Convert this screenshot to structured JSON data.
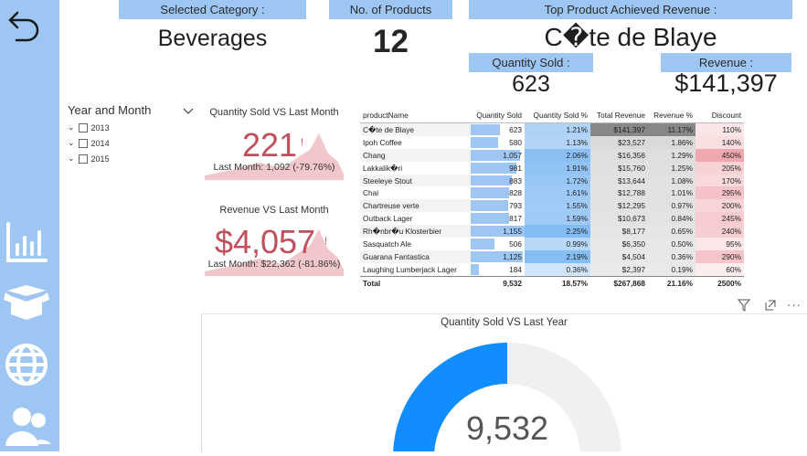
{
  "header": {
    "selected_category_label": "Selected Category :",
    "selected_category_value": "Beverages",
    "num_products_label": "No. of Products",
    "num_products_value": "12",
    "top_product_label": "Top Product Achieved Revenue :",
    "top_product_value": "C�te de Blaye",
    "qty_sold_label": "Quantity Sold :",
    "qty_sold_value": "623",
    "revenue_label": "Revenue :",
    "revenue_value": "$141,397"
  },
  "slicer": {
    "title": "Year and Month",
    "years": [
      "2013",
      "2014",
      "2015"
    ]
  },
  "kpi_qty": {
    "title": "Quantity Sold VS Last Month",
    "value": "221",
    "indicator": "!",
    "sub": "Last Month: 1,092 (-79.76%)"
  },
  "kpi_rev": {
    "title": "Revenue VS Last Month",
    "value": "$4,057",
    "indicator": "!",
    "sub": "Last Month: $22,362 (-81.86%)"
  },
  "matrix": {
    "columns": [
      "productName",
      "Quantity Sold",
      "Quantity Sold %",
      "Total Revenue",
      "Revenue %",
      "Discount"
    ],
    "rows": [
      {
        "name": "C�te de Blaye",
        "qty": "623",
        "qty_pct": "1.21%",
        "rev": "$141,397",
        "rev_pct": "11.17%",
        "disc": "110%"
      },
      {
        "name": "Ipoh Coffee",
        "qty": "580",
        "qty_pct": "1.13%",
        "rev": "$23,527",
        "rev_pct": "1.86%",
        "disc": "140%"
      },
      {
        "name": "Chang",
        "qty": "1,057",
        "qty_pct": "2.06%",
        "rev": "$16,356",
        "rev_pct": "1.29%",
        "disc": "450%"
      },
      {
        "name": "Lakkalik�ri",
        "qty": "981",
        "qty_pct": "1.91%",
        "rev": "$15,760",
        "rev_pct": "1.25%",
        "disc": "205%"
      },
      {
        "name": "Steeleye Stout",
        "qty": "883",
        "qty_pct": "1.72%",
        "rev": "$13,644",
        "rev_pct": "1.08%",
        "disc": "170%"
      },
      {
        "name": "Chai",
        "qty": "828",
        "qty_pct": "1.61%",
        "rev": "$12,788",
        "rev_pct": "1.01%",
        "disc": "295%"
      },
      {
        "name": "Chartreuse verte",
        "qty": "793",
        "qty_pct": "1.55%",
        "rev": "$12,295",
        "rev_pct": "0.97%",
        "disc": "200%"
      },
      {
        "name": "Outback Lager",
        "qty": "817",
        "qty_pct": "1.59%",
        "rev": "$10,673",
        "rev_pct": "0.84%",
        "disc": "245%"
      },
      {
        "name": "Rh�nbr�u Klosterbier",
        "qty": "1,155",
        "qty_pct": "2.25%",
        "rev": "$8,177",
        "rev_pct": "0.65%",
        "disc": "240%"
      },
      {
        "name": "Sasquatch Ale",
        "qty": "506",
        "qty_pct": "0.99%",
        "rev": "$6,350",
        "rev_pct": "0.50%",
        "disc": "95%"
      },
      {
        "name": "Guarana Fantastica",
        "qty": "1,125",
        "qty_pct": "2.19%",
        "rev": "$4,504",
        "rev_pct": "0.36%",
        "disc": "290%"
      },
      {
        "name": "Laughing Lumberjack Lager",
        "qty": "184",
        "qty_pct": "0.36%",
        "rev": "$2,397",
        "rev_pct": "0.19%",
        "disc": "60%"
      }
    ],
    "total": {
      "label": "Total",
      "qty": "9,532",
      "qty_pct": "18.57%",
      "rev": "$267,868",
      "rev_pct": "21.16%",
      "disc": "2500%"
    }
  },
  "gauge": {
    "title": "Quantity Sold VS Last Year",
    "value": "9,532",
    "fraction": 0.5
  },
  "icons": {
    "back": "undo-arrow-icon",
    "chart": "bar-chart-icon",
    "box": "open-box-icon",
    "globe": "globe-icon",
    "users": "users-icon",
    "filter": "filter-icon",
    "focus": "focus-mode-icon",
    "more": "more-options-icon"
  },
  "colors": {
    "accent": "#9ec6f2",
    "kpi_red": "#c0505b",
    "gauge_blue": "#118dff",
    "gauge_track": "#f0f0f0"
  }
}
